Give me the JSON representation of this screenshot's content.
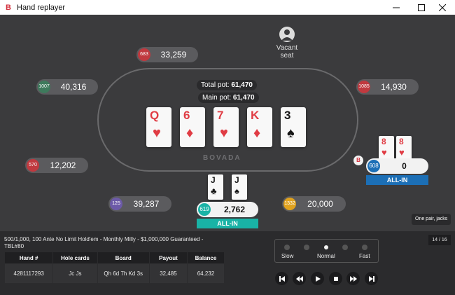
{
  "window": {
    "title": "Hand replayer"
  },
  "table": {
    "total_pot_label": "Total pot:",
    "total_pot": "61,470",
    "main_pot_label": "Main pot:",
    "main_pot": "61,470",
    "brand": "BOVADA",
    "board": [
      {
        "rank": "Q",
        "suit": "♥",
        "color": "red"
      },
      {
        "rank": "6",
        "suit": "♦",
        "color": "red"
      },
      {
        "rank": "7",
        "suit": "♥",
        "color": "red"
      },
      {
        "rank": "K",
        "suit": "♦",
        "color": "red"
      },
      {
        "rank": "3",
        "suit": "♠",
        "color": "black"
      }
    ]
  },
  "seats": {
    "top_left": {
      "chip": "683",
      "stack": "33,259",
      "color": "#c0393f"
    },
    "left_upper": {
      "chip": "1007",
      "stack": "40,316",
      "color": "#3e7a5c"
    },
    "right_upper": {
      "chip": "1085",
      "stack": "14,930",
      "color": "#c0393f"
    },
    "left_lower": {
      "chip": "570",
      "stack": "12,202",
      "color": "#c0393f"
    },
    "bottom_left": {
      "chip": "125",
      "stack": "39,287",
      "color": "#6c5aa8"
    },
    "bottom_right": {
      "chip": "1332",
      "stack": "20,000",
      "color": "#e0a21e"
    },
    "vacant": {
      "line1": "Vacant",
      "line2": "seat"
    },
    "hero": {
      "chip": "619",
      "stack": "2,762",
      "status": "ALL-IN",
      "cards": [
        {
          "rank": "J",
          "suit": "♣",
          "color": "black"
        },
        {
          "rank": "J",
          "suit": "♠",
          "color": "black"
        }
      ]
    },
    "villain": {
      "chip": "608",
      "stack": "0",
      "status": "ALL-IN",
      "dealer": "B",
      "cards": [
        {
          "rank": "8",
          "suit": "♥",
          "color": "red"
        },
        {
          "rank": "8",
          "suit": "♥",
          "color": "red"
        }
      ]
    }
  },
  "hand_name": "One pair, jacks",
  "counter": "14 / 16",
  "info": {
    "description": "500/1,000, 100 Ante No Limit Hold'em - Monthly Milly - $1,000,000 Guaranteed - TBL#80",
    "columns": [
      "Hand #",
      "Hole cards",
      "Board",
      "Payout",
      "Balance"
    ],
    "row": [
      "4281117293",
      "Jc Js",
      "Qh 6d 7h Kd 3s",
      "32,485",
      "64,232"
    ]
  },
  "speed": {
    "labels": [
      "Slow",
      "Normal",
      "Fast"
    ],
    "selected": "Normal"
  },
  "colors": {
    "accent": "#19b3a6",
    "brand_red": "#d32f3c",
    "allin_blue": "#1c6fb6"
  }
}
